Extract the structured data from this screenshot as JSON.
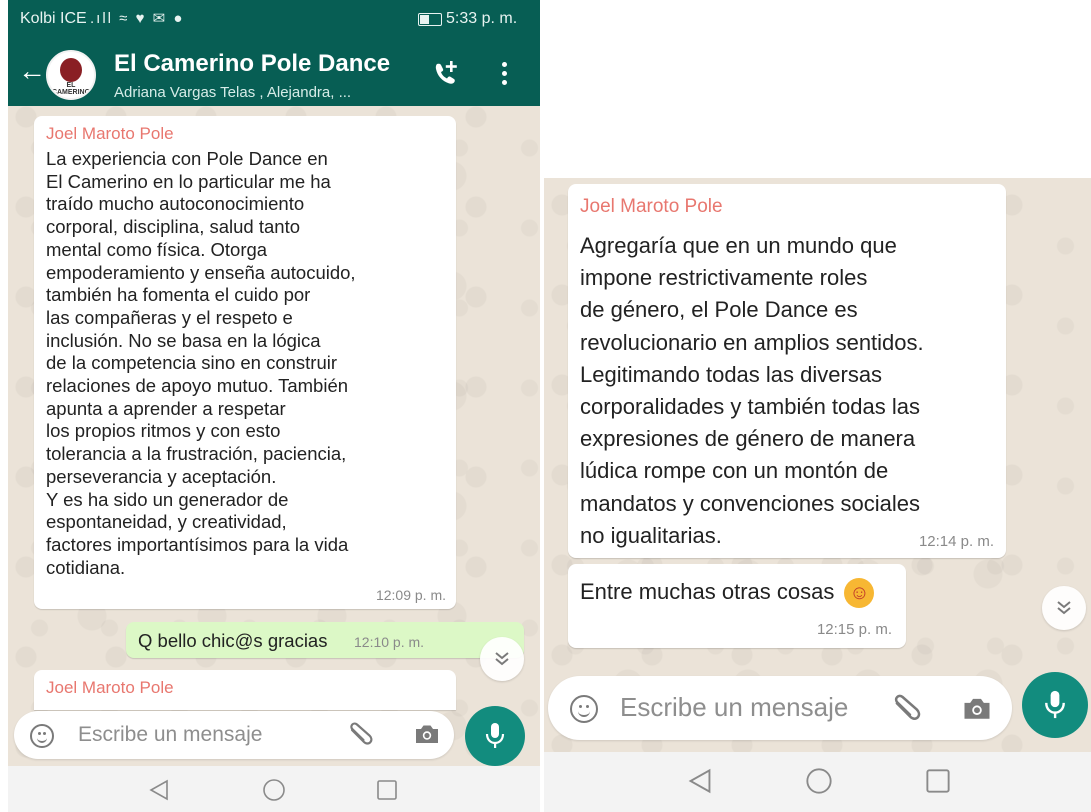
{
  "left_screen": {
    "status": {
      "carrier": "Kolbi ICE",
      "icons": ".ıll ≈ ♥ ✉ ●",
      "time": "5:33 p. m."
    },
    "header": {
      "avatar_text": "EL CAMERINO",
      "title": "El Camerino Pole Dance",
      "subtitle": "Adriana Vargas Telas , Alejandra, ..."
    },
    "messages": [
      {
        "sender": "Joel Maroto Pole",
        "text": "La experiencia con Pole Dance en\nEl Camerino en lo particular me ha\ntraído mucho autoconocimiento\ncorporal, disciplina, salud tanto\nmental como física. Otorga\nempoderamiento y enseña autocuido,\ntambién ha fomenta el cuido por\nlas compañeras y el respeto e\ninclusión. No se basa en la lógica\nde la competencia sino en construir\nrelaciones de apoyo mutuo. También\napunta a aprender a respetar\nlos propios ritmos y con esto\ntolerancia a la frustración, paciencia,\nperseverancia y aceptación.\nY es ha sido un generador de\nespontaneidad, y creatividad,\nfactores importantísimos para la vida\ncotidiana.",
        "time": "12:09 p. m."
      },
      {
        "text": "Q bello chic@s gracias",
        "time": "12:10 p. m."
      },
      {
        "sender": "Joel Maroto Pole"
      }
    ],
    "composer": {
      "placeholder": "Escribe un mensaje"
    }
  },
  "right_screen": {
    "messages": [
      {
        "sender": "Joel Maroto Pole",
        "text": "Agregaría que en un mundo que\nimpone restrictivamente roles\nde género, el Pole Dance es\nrevolucionario en amplios sentidos.\nLegitimando todas las diversas\ncorporalidades  y también todas las\nexpresiones de género de manera\nlúdica rompe con un montón de\nmandatos y convenciones sociales\nno igualitarias.",
        "time": "12:14 p. m."
      },
      {
        "text": "Entre muchas otras cosas",
        "emoji": "☺",
        "time": "12:15 p. m."
      }
    ],
    "composer": {
      "placeholder": "Escribe un mensaje"
    }
  },
  "colors": {
    "header": "#075e54",
    "accent": "#128c7e",
    "outgoing_bubble": "#dcf8c6",
    "sender_name": "#e8776f"
  },
  "icons": [
    "back-arrow-icon",
    "add-call-icon",
    "more-vert-icon",
    "emoji-icon",
    "attach-icon",
    "camera-icon",
    "mic-icon",
    "scroll-down-icon",
    "nav-back-icon",
    "nav-home-icon",
    "nav-recents-icon"
  ]
}
